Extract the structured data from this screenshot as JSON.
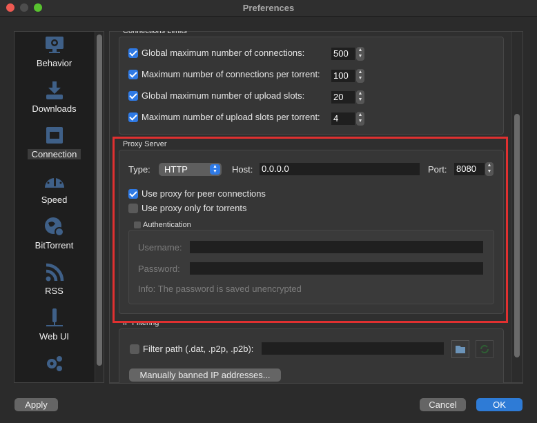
{
  "window": {
    "title": "Preferences"
  },
  "sidebar": {
    "items": [
      {
        "label": "Behavior",
        "icon": "monitor-gear-icon"
      },
      {
        "label": "Downloads",
        "icon": "download-icon"
      },
      {
        "label": "Connection",
        "icon": "ethernet-icon",
        "selected": true
      },
      {
        "label": "Speed",
        "icon": "speedometer-icon"
      },
      {
        "label": "BitTorrent",
        "icon": "globe-gear-icon"
      },
      {
        "label": "RSS",
        "icon": "rss-icon"
      },
      {
        "label": "Web UI",
        "icon": "webui-icon"
      },
      {
        "label": "",
        "icon": "gears-icon"
      }
    ]
  },
  "connection_limits": {
    "title": "Connections Limits",
    "rows": [
      {
        "label": "Global maximum number of connections:",
        "value": "500",
        "checked": true
      },
      {
        "label": "Maximum number of connections per torrent:",
        "value": "100",
        "checked": true
      },
      {
        "label": "Global maximum number of upload slots:",
        "value": "20",
        "checked": true
      },
      {
        "label": "Maximum number of upload slots per torrent:",
        "value": "4",
        "checked": true
      }
    ]
  },
  "proxy": {
    "title": "Proxy Server",
    "type_label": "Type:",
    "type_value": "HTTP",
    "host_label": "Host:",
    "host_value": "0.0.0.0",
    "port_label": "Port:",
    "port_value": "8080",
    "peer_label": "Use proxy for peer connections",
    "peer_checked": true,
    "torrents_label": "Use proxy only for torrents",
    "torrents_checked": false,
    "auth_label": "Authentication",
    "auth_checked": false,
    "username_label": "Username:",
    "username_value": "",
    "password_label": "Password:",
    "password_value": "",
    "info": "Info: The password is saved unencrypted"
  },
  "ip_filtering": {
    "title": "IP Filtering",
    "filter_label": "Filter path (.dat, .p2p, .p2b):",
    "filter_value": "",
    "filter_checked": false,
    "banned_button": "Manually banned IP addresses..."
  },
  "footer": {
    "apply": "Apply",
    "cancel": "Cancel",
    "ok": "OK"
  },
  "colors": {
    "accent": "#2f7ae5",
    "highlight": "#e03030",
    "icon": "#3f6088"
  }
}
